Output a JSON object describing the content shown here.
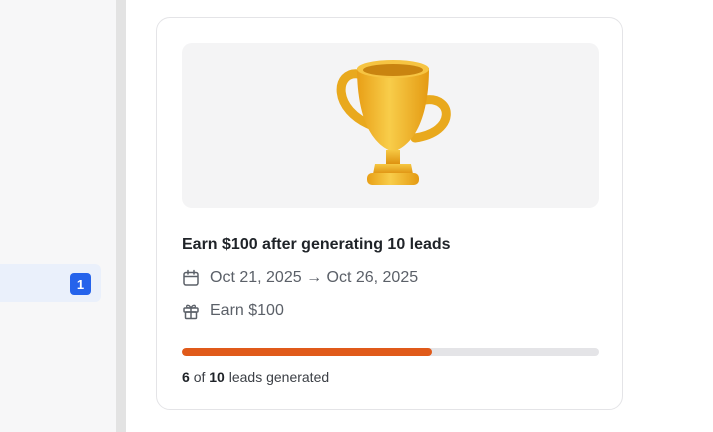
{
  "sidebar": {
    "selected_item": {
      "badge": "1"
    }
  },
  "card": {
    "title": "Earn $100 after generating 10 leads",
    "date_range": "Oct 21, 2025 → Oct 26, 2025",
    "reward": "Earn $100",
    "progress": {
      "current": "6",
      "of_word": "of",
      "target": "10",
      "suffix": "leads generated",
      "fraction": 0.6
    }
  },
  "icons": {
    "hero": "trophy-icon",
    "date": "calendar-icon",
    "reward": "gift-icon"
  },
  "colors": {
    "accent": "#2563eb",
    "progress": "#e05a1a",
    "trophy": "#f2b92c"
  }
}
